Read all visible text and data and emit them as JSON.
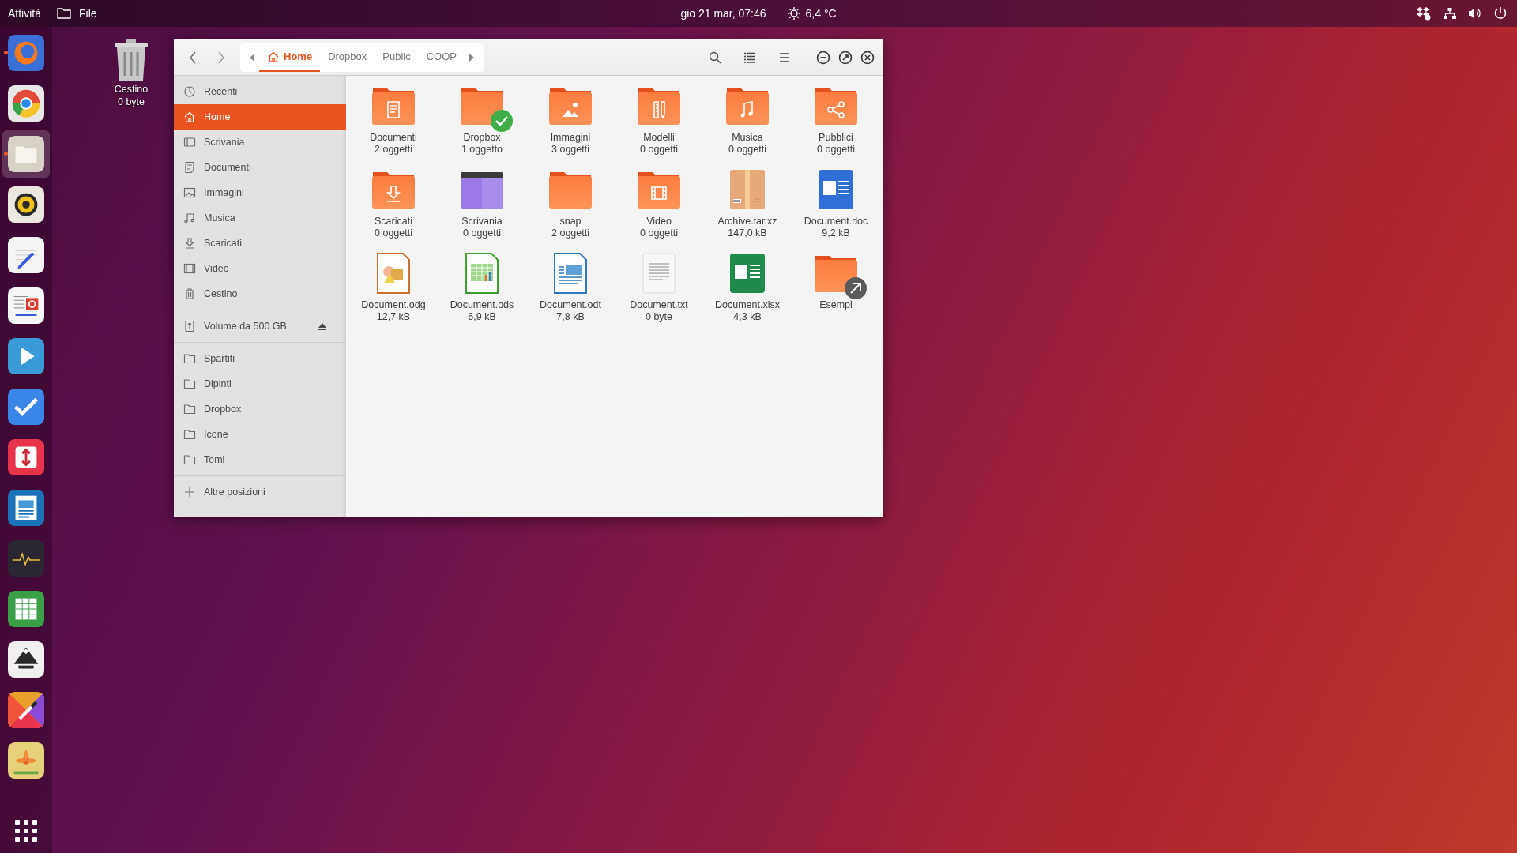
{
  "top_bar": {
    "activities": "Attività",
    "app_menu": "File",
    "clock": "gio 21 mar, 07:46",
    "weather": "6,4 °C"
  },
  "dock": {
    "apps": [
      {
        "kind": "browser",
        "running": true,
        "selected": false
      },
      {
        "kind": "web-browser",
        "running": false,
        "selected": false
      },
      {
        "kind": "files",
        "running": true,
        "selected": true
      },
      {
        "kind": "speaker",
        "running": false,
        "selected": false
      },
      {
        "kind": "text-editor",
        "running": false,
        "selected": false
      },
      {
        "kind": "news-reader",
        "running": false,
        "selected": false
      },
      {
        "kind": "video-player",
        "running": false,
        "selected": false
      },
      {
        "kind": "checklist",
        "running": false,
        "selected": false
      },
      {
        "kind": "transfer",
        "running": false,
        "selected": false
      },
      {
        "kind": "writer",
        "running": false,
        "selected": false
      },
      {
        "kind": "system-monitor",
        "running": false,
        "selected": false
      },
      {
        "kind": "spreadsheet",
        "running": false,
        "selected": false
      },
      {
        "kind": "vector-editor",
        "running": false,
        "selected": false
      },
      {
        "kind": "color-picker",
        "running": false,
        "selected": false
      },
      {
        "kind": "photo-viewer",
        "running": false,
        "selected": false
      }
    ]
  },
  "desktop": {
    "icons": [
      {
        "label": "Cestino",
        "detail": "0 byte"
      }
    ]
  },
  "window": {
    "path": [
      {
        "label": "Home",
        "selected": true
      },
      {
        "label": "Dropbox",
        "selected": false
      },
      {
        "label": "Public",
        "selected": false
      },
      {
        "label": "COOP",
        "selected": false
      }
    ],
    "sidebar": {
      "groups": [
        {
          "items": [
            {
              "label": "Recenti",
              "kind": "recent",
              "selected": false
            },
            {
              "label": "Home",
              "kind": "home",
              "selected": true
            },
            {
              "label": "Scrivania",
              "kind": "desktop",
              "selected": false
            },
            {
              "label": "Documenti",
              "kind": "documents",
              "selected": false
            },
            {
              "label": "Immagini",
              "kind": "pictures",
              "selected": false
            },
            {
              "label": "Musica",
              "kind": "music",
              "selected": false
            },
            {
              "label": "Scaricati",
              "kind": "downloads",
              "selected": false
            },
            {
              "label": "Video",
              "kind": "video",
              "selected": false
            },
            {
              "label": "Cestino",
              "kind": "trash",
              "selected": false
            }
          ]
        },
        {
          "items": [
            {
              "label": "Volume da 500 GB",
              "kind": "drive",
              "selected": false
            }
          ]
        },
        {
          "items": [
            {
              "label": "Spartiti",
              "kind": "folder",
              "selected": false
            },
            {
              "label": "Dipinti",
              "kind": "folder",
              "selected": false
            },
            {
              "label": "Dropbox",
              "kind": "folder",
              "selected": false
            },
            {
              "label": "Icone",
              "kind": "folder",
              "selected": false
            },
            {
              "label": "Temi",
              "kind": "folder",
              "selected": false
            }
          ]
        },
        {
          "items": [
            {
              "label": "Altre posizioni",
              "kind": "add",
              "selected": false
            }
          ]
        }
      ]
    },
    "files": [
      {
        "label": "Documenti",
        "detail": "2 oggetti",
        "kind": "folder-document"
      },
      {
        "label": "Dropbox",
        "detail": "1 oggetto",
        "kind": "folder-synced"
      },
      {
        "label": "Immagini",
        "detail": "3 oggetti",
        "kind": "folder-picture"
      },
      {
        "label": "Modelli",
        "detail": "0 oggetti",
        "kind": "folder-templates"
      },
      {
        "label": "Musica",
        "detail": "0 oggetti",
        "kind": "folder-music"
      },
      {
        "label": "Pubblici",
        "detail": "0 oggetti",
        "kind": "folder-share"
      },
      {
        "label": "Scaricati",
        "detail": "0 oggetti",
        "kind": "folder-download"
      },
      {
        "label": "Scrivania",
        "detail": "0 oggetti",
        "kind": "desktop"
      },
      {
        "label": "snap",
        "detail": "2 oggetti",
        "kind": "folder"
      },
      {
        "label": "Video",
        "detail": "0 oggetti",
        "kind": "folder-video"
      },
      {
        "label": "Archive.tar.xz",
        "detail": "147,0 kB",
        "kind": "archive"
      },
      {
        "label": "Document.doc",
        "detail": "9,2 kB",
        "kind": "word"
      },
      {
        "label": "Document.odg",
        "detail": "12,7 kB",
        "kind": "drawing"
      },
      {
        "label": "Document.ods",
        "detail": "6,9 kB",
        "kind": "spreadsheet"
      },
      {
        "label": "Document.odt",
        "detail": "7,8 kB",
        "kind": "textdoc"
      },
      {
        "label": "Document.txt",
        "detail": "0 byte",
        "kind": "plaintext"
      },
      {
        "label": "Document.xlsx",
        "detail": "4,3 kB",
        "kind": "excel"
      },
      {
        "label": "Esempi",
        "kind": "folder-link"
      }
    ]
  }
}
